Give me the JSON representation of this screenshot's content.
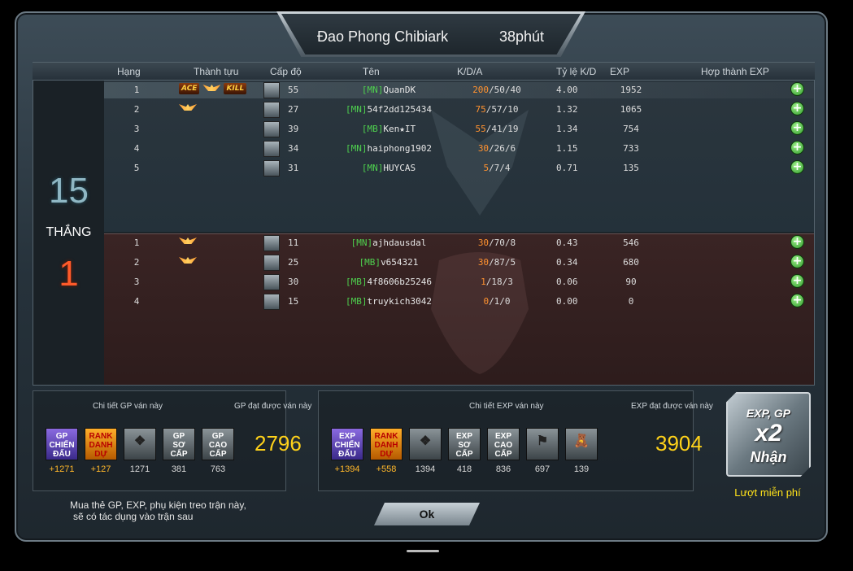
{
  "title": {
    "map_name": "Đao Phong Chibiark",
    "time": "38phút"
  },
  "headers": {
    "rank": "Hạng",
    "achievement": "Thành tựu",
    "level": "Cấp độ",
    "name": "Tên",
    "kda": "K/D/A",
    "ratio": "Tỷ lệ K/D",
    "exp": "EXP",
    "merge": "Hợp thành EXP"
  },
  "score": {
    "win": "15",
    "win_label": "THẮNG",
    "lose": "1"
  },
  "team_a": [
    {
      "rank": "1",
      "badges": [
        "ACE",
        "wing",
        "KILL"
      ],
      "level": "55",
      "tag": "[MN]",
      "name": "QuanDK",
      "kills": "200",
      "da": "/50/40",
      "ratio": "4.00",
      "exp": "1952"
    },
    {
      "rank": "2",
      "badges": [
        "wing"
      ],
      "level": "27",
      "tag": "[MN]",
      "name": "54f2dd125434",
      "kills": "75",
      "da": "/57/10",
      "ratio": "1.32",
      "exp": "1065"
    },
    {
      "rank": "3",
      "badges": [],
      "level": "39",
      "tag": "[MB]",
      "name": "Ken★IT",
      "kills": "55",
      "da": "/41/19",
      "ratio": "1.34",
      "exp": "754"
    },
    {
      "rank": "4",
      "badges": [],
      "level": "34",
      "tag": "[MN]",
      "name": "haiphong1902",
      "kills": "30",
      "da": "/26/6",
      "ratio": "1.15",
      "exp": "733"
    },
    {
      "rank": "5",
      "badges": [],
      "level": "31",
      "tag": "[MN]",
      "name": "HUYCAS",
      "kills": "5",
      "da": "/7/4",
      "ratio": "0.71",
      "exp": "135"
    }
  ],
  "team_b": [
    {
      "rank": "1",
      "badges": [
        "wing"
      ],
      "level": "11",
      "tag": "[MN]",
      "name": "ajhdausdal",
      "kills": "30",
      "da": "/70/8",
      "ratio": "0.43",
      "exp": "546"
    },
    {
      "rank": "2",
      "badges": [
        "wing"
      ],
      "level": "25",
      "tag": "[MB]",
      "name": "v654321",
      "kills": "30",
      "da": "/87/5",
      "ratio": "0.34",
      "exp": "680"
    },
    {
      "rank": "3",
      "badges": [],
      "level": "30",
      "tag": "[MB]",
      "name": "4f8606b25246",
      "kills": "1",
      "da": "/18/3",
      "ratio": "0.06",
      "exp": "90"
    },
    {
      "rank": "4",
      "badges": [],
      "level": "15",
      "tag": "[MB]",
      "name": "truykich3042",
      "kills": "0",
      "da": "/1/0",
      "ratio": "0.00",
      "exp": "0"
    }
  ],
  "gp_panel": {
    "caption_left": "Chi tiết GP ván này",
    "caption_right": "GP đạt được ván này",
    "total": "2796",
    "items": [
      {
        "label": "GP\nCHIẾN\nĐẤU",
        "style": "purple",
        "value": "+1271",
        "highlight": true
      },
      {
        "label": "RANK\nDANH\nDỰ",
        "style": "orange",
        "value": "+127",
        "highlight": true
      },
      {
        "label": "",
        "style": "grey",
        "icon": "wolf-emblem-icon",
        "value": "1271",
        "highlight": false
      },
      {
        "label": "GP\nSƠ CẤP",
        "style": "grey",
        "value": "381",
        "highlight": false
      },
      {
        "label": "GP\nCAO CẤP",
        "style": "grey",
        "value": "763",
        "highlight": false
      }
    ]
  },
  "exp_panel": {
    "caption_left": "Chi tiết EXP ván này",
    "caption_right": "EXP đạt được ván này",
    "total": "3904",
    "items": [
      {
        "label": "EXP\nCHIẾN\nĐẤU",
        "style": "purple",
        "value": "+1394",
        "highlight": true
      },
      {
        "label": "RANK\nDANH\nDỰ",
        "style": "orange",
        "value": "+558",
        "highlight": true
      },
      {
        "label": "",
        "style": "grey",
        "icon": "wolf-emblem-icon",
        "value": "1394",
        "highlight": false
      },
      {
        "label": "EXP\nSƠ CẤP",
        "style": "grey",
        "value": "418",
        "highlight": false
      },
      {
        "label": "EXP\nCAO CẤP",
        "style": "grey",
        "value": "836",
        "highlight": false
      },
      {
        "label": "",
        "style": "grey",
        "icon": "flags-icon",
        "value": "697",
        "highlight": false
      },
      {
        "label": "",
        "style": "grey",
        "icon": "teddy-bear-icon",
        "value": "139",
        "highlight": false
      }
    ]
  },
  "bonus": {
    "line1": "EXP, GP",
    "line2": "x2",
    "line3": "Nhận",
    "free_label": "Lượt miễn phí"
  },
  "note": {
    "line1": "Mua thẻ GP, EXP, phụ kiện treo trận này,",
    "line2": "sẽ có tác dụng vào trận sau"
  },
  "ok_label": "Ok",
  "colors": {
    "kill": "#ff9230",
    "tag": "#4ed04e",
    "total": "#ffd21a",
    "win": "#8fb7c4",
    "lose": "#ff5a2a"
  }
}
